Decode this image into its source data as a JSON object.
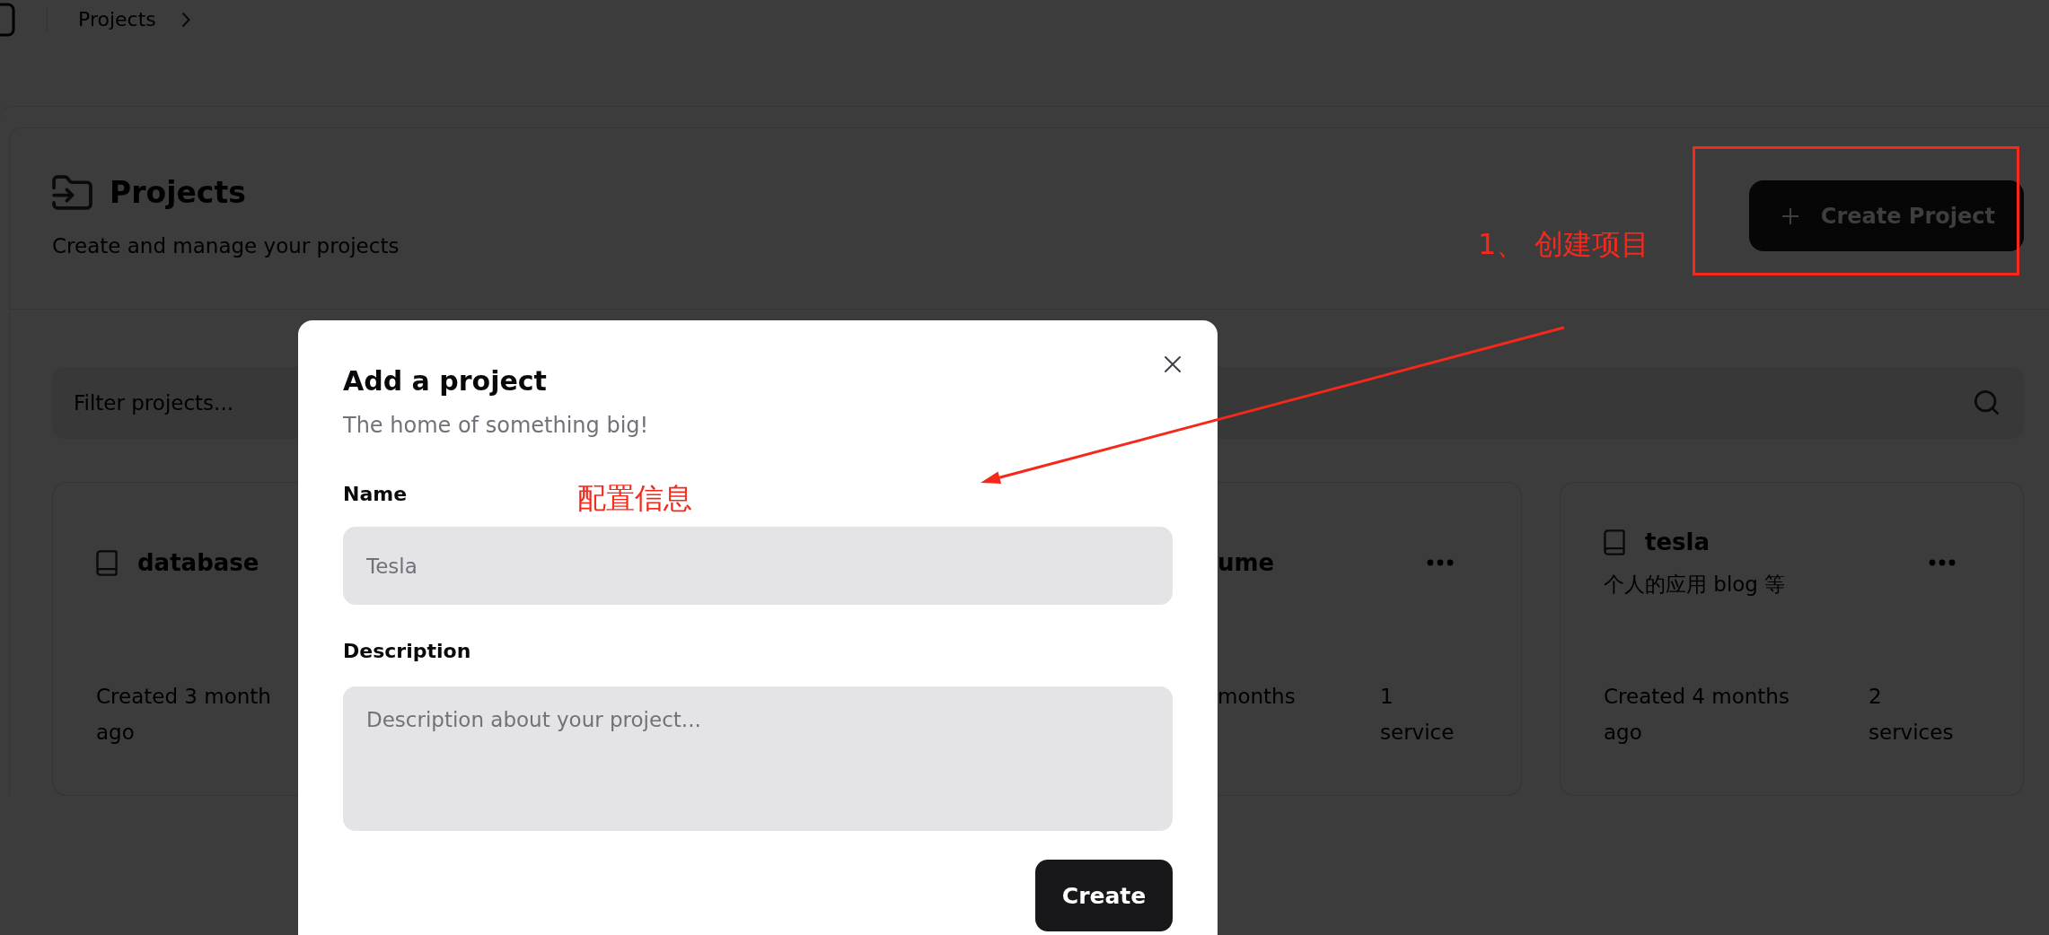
{
  "topbar": {
    "breadcrumb": "Projects"
  },
  "header": {
    "title": "Projects",
    "subtitle": "Create and manage your projects",
    "create_button": "Create Project"
  },
  "filter": {
    "placeholder": "Filter projects..."
  },
  "cards": [
    {
      "kind": "cut_right",
      "title": "database",
      "created": "Created 3 month ago"
    },
    {
      "kind": "cut_left",
      "title": "ume",
      "created": "months",
      "services": "1 service"
    },
    {
      "kind": "full",
      "title": "tesla",
      "description": "个人的应用 blog 等",
      "created": "Created 4 months ago",
      "services": "2 services"
    }
  ],
  "modal": {
    "title": "Add a project",
    "subtitle": "The home of something big!",
    "fields": [
      {
        "kind": "input",
        "label": "Name",
        "placeholder": "Tesla"
      },
      {
        "kind": "textarea",
        "label": "Description",
        "placeholder": "Description about your project..."
      }
    ],
    "submit": "Create"
  },
  "annotations": [
    {
      "kind": "frame"
    },
    {
      "kind": "label",
      "text": "1、 创建项目"
    },
    {
      "kind": "arrow"
    },
    {
      "kind": "label",
      "text": "配置信息"
    }
  ]
}
